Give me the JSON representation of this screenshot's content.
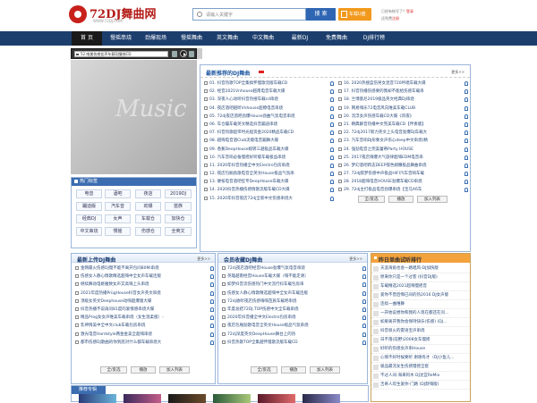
{
  "header": {
    "logo_text": "72DJ舞曲网",
    "logo_sub": "WWW.72DJ.COM",
    "search_placeholder": "请输入关键字",
    "search_button": "搜 索",
    "cart_button": "车载U盘",
    "login_prefix": "已经有帐号了？",
    "login_link": "登录",
    "register_prefix": "还免费",
    "register_link": "注册"
  },
  "nav": [
    "首 页",
    "慢摇串烧",
    "劲爆现场",
    "慢摇舞曲",
    "英文舞曲",
    "中文舞曲",
    "最新DJ",
    "免费舞曲",
    "DJ排行榜"
  ],
  "player": {
    "current": "52.唯美伤感女声车载DJ慢摇CD"
  },
  "visual": {
    "text": "Music"
  },
  "hot": {
    "title": "热门标签",
    "tags": [
      "电音",
      "酒吧",
      "夜店",
      "2019DJ",
      "蹦迪版",
      "汽车音",
      "劲爆",
      "苗族",
      "经典DJ",
      "女声",
      "车载仓",
      "加快仓",
      "中文串烧",
      "慢摇",
      "伤感仓",
      "全英文"
    ]
  },
  "latest": {
    "title": "最新推荐的DJ舞曲",
    "more": "更多>>",
    "left": [
      "01. 抖音热歌TOP全集搞怀慢歌流版车载CD",
      "02. 经音2021Vnhouse越南电音车载大碟",
      "03. 深夜人心动听抖音热搜车载cd串烧",
      "04. 夜店酒吧越听Vnhouse超撩电音串烧",
      "05. 72dj夜店酒吧劲爆House劲曲气氛电音串烧",
      "06. 车仓蹦车载英文精选抖音蹦迪串烧",
      "07. 抖音热歌超带时光船资金2020精品车载CD",
      "08. 越嗨电音酒Club流版电音蹦舞大碟",
      "09. 香蕉DeepHouse婉转三越极品车载大碟",
      "10. 汽车音响必备慢摇好听版车载极品串烧",
      "11. 2020年抖音热播全中文Electro包房串烧",
      "12. 夜店包厢劲歌电音全英文House极品气氛串",
      "13. 硬核电音酒吧狂专DeepHouse车载大碟",
      "14. 2020抖音热播伤感情歌流版车载CD大碟",
      "15. 2020年抖音夜店72dj全新中文伤感串烧大"
    ],
    "right": [
      "16. 2020热搜蓝伤男女混音720吟唱车载大碟",
      "17. 抖音热播伤感要的我却不能给伤感车载串",
      "18. 兰博基尼2019极品英文经典DJ串烧",
      "19. 网易嗨乐72电音风向唯美车载CLUB",
      "20. 流浮女声伤感车载CD大碟《风夜》",
      "21. 精典解音热播中文完美车载CD【伴奏版】",
      "22. 72dj2017新力英文上头电音劲爆DJ车载大",
      "23. 汽车音响DJ形象女声伤心deep中文串烧(精",
      "24. 强劲电音之完美蕾蒂Party HOUSE",
      "25. 2017夜店嗨爆大气旋律超嗨EDM电音串",
      "26. 梦幻酒吧跨志DEEP夜色婉撒极品舞曲串烧",
      "27. 72dj醉梦伤感中声极品HIFI汽车音响车载",
      "28. 2018超嗨电音HOUSE劲爆车载CD串烧",
      "29. 72dj主打极品电音劲爆串烧【宝马X6车"
    ],
    "select_all": "全/反选",
    "play": "播放",
    "add_list": "加入列表"
  },
  "upload": {
    "title": "最新上传DJ舞曲",
    "more": "更多>>",
    "items": [
      "金网最火伤感DJ慢不能不离开包间80Mi串烧",
      "伤感女人静心情歌精选超嗨中全女声车载连版",
      "继续舞动电姬雅致女声又高嗨上头串烧",
      "2021年度热播PrügHouse抖音女声英文串烧",
      "顶级女英文Deephouse动嗨超爆版大碟",
      "抖音热播不说再问81度的爱情感串烧大碟",
      "精品Prog女女声唯美车载串烧（女生温柔版）-",
      "乳神情美中全中文club车载包房串烧",
      "激光电音Hardstyle两金金美全超嗨串烧",
      "都市伤感DJ歌曲的你到底对什么都车载串烧大"
    ],
    "select_all": "全/反选",
    "play": "播放",
    "add_list": "加入列表"
  },
  "member": {
    "title": "会员收藏DJ舞曲",
    "more": "更多>>",
    "items": [
      "72dj夜店酒吧经音House劲爆气氛电音串烧",
      "英雄越南经音House车载大碟（嗨不能走清）",
      "如梦抖音流伤感热门中文流行抖车载包房串",
      "伤感女人静心情歌精选超嗨中全女声车载连版",
      "72dj收听夜店伤感嗨嗨苗族车载吧串烧",
      "年度总结72DJ.TOP伤感中文全车载串烧",
      "2020年抖音播全中文Electro包房串烧",
      "夜店包厢劲歌电音全英文House极品气氛串烧",
      "72dj深度英文DeepHouse舞台上的热",
      "抖音热歌TOP全集越怀慢歌流版车载CD"
    ],
    "select_all": "全/反选",
    "play": "播放",
    "add_list": "加入列表"
  },
  "rank": {
    "title": "昨日单曲试听排行",
    "items": [
      "天涯海角也会一路唱风-DJ加快版",
      "原来你只是一个过客 (抖音DJ版)",
      "车载精选2021超嗨慢摇音",
      "爱你不曾后悔已间的热2016 DJ女声版",
      "连续一曲唯舞",
      "一开始说想你和我的人现在都还在问...",
      "如果离开我你会保持快乐(伤感) (DJ...",
      "抖音很火的雷语宝声串烧",
      "日不落(前野)2008女车慢摇",
      "好听的伤感女声串House",
      "心情不好时候要听 谢谢有才（DJ小鱼儿...",
      "极品最流女生伤感慢摇全套",
      "不过人间-海来阿木 DJ沈宜ReMix",
      "吉奇人欢生爱你-门路 (DJ默嗨版)"
    ]
  },
  "recommend": {
    "title": "推荐专辑"
  },
  "colors": {
    "nav_bg": "#1c3e6d",
    "accent_blue": "#2f66b3",
    "accent_orange": "#f29a1d",
    "logo_red": "#b31c18"
  }
}
